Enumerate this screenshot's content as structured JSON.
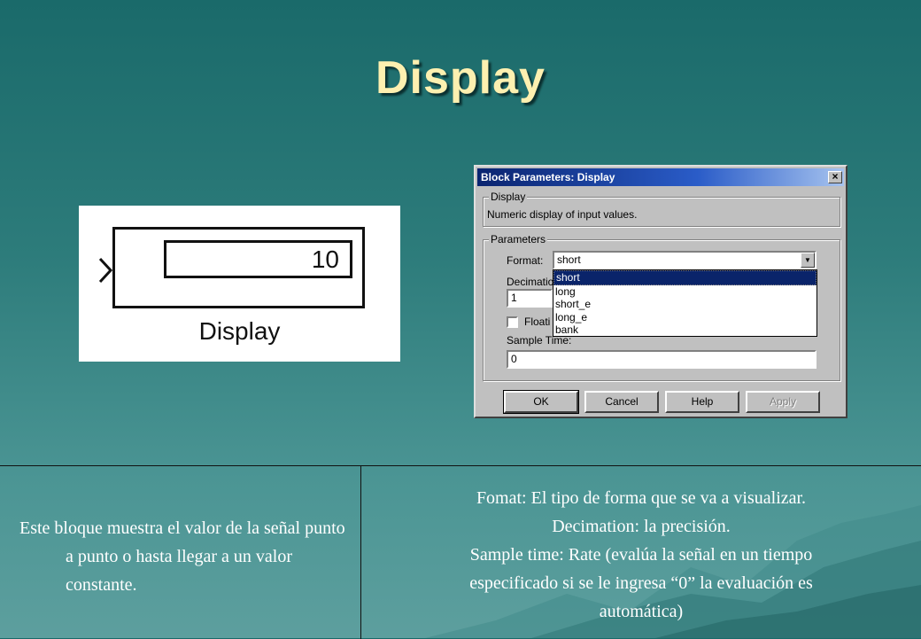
{
  "slide": {
    "title": "Display"
  },
  "block_image": {
    "value": "10",
    "caption": "Display"
  },
  "dialog": {
    "title": "Block Parameters: Display",
    "close_glyph": "×",
    "display_group": {
      "label": "Display",
      "description": "Numeric display of input values."
    },
    "parameters_group": {
      "label": "Parameters",
      "format_label": "Format:",
      "format_value": "short",
      "format_options": [
        "short",
        "long",
        "short_e",
        "long_e",
        "bank"
      ],
      "decimation_label": "Decimatio",
      "decimation_value": "1",
      "floating_label": "Floati",
      "sample_time_label": "Sample Time:",
      "sample_time_value": "0"
    },
    "buttons": {
      "ok": "OK",
      "cancel": "Cancel",
      "help": "Help",
      "apply": "Apply"
    }
  },
  "table": {
    "left_text": "Este bloque muestra el valor de la señal punto a punto o hasta llegar a un valor constante.",
    "right_lines": [
      "Fomat: El tipo de forma que se va a visualizar.",
      "Decimation: la precisión.",
      "Sample time: Rate (evalúa la señal en un tiempo",
      "especificado si se le ingresa “0” la evaluación es",
      "automática)"
    ]
  }
}
